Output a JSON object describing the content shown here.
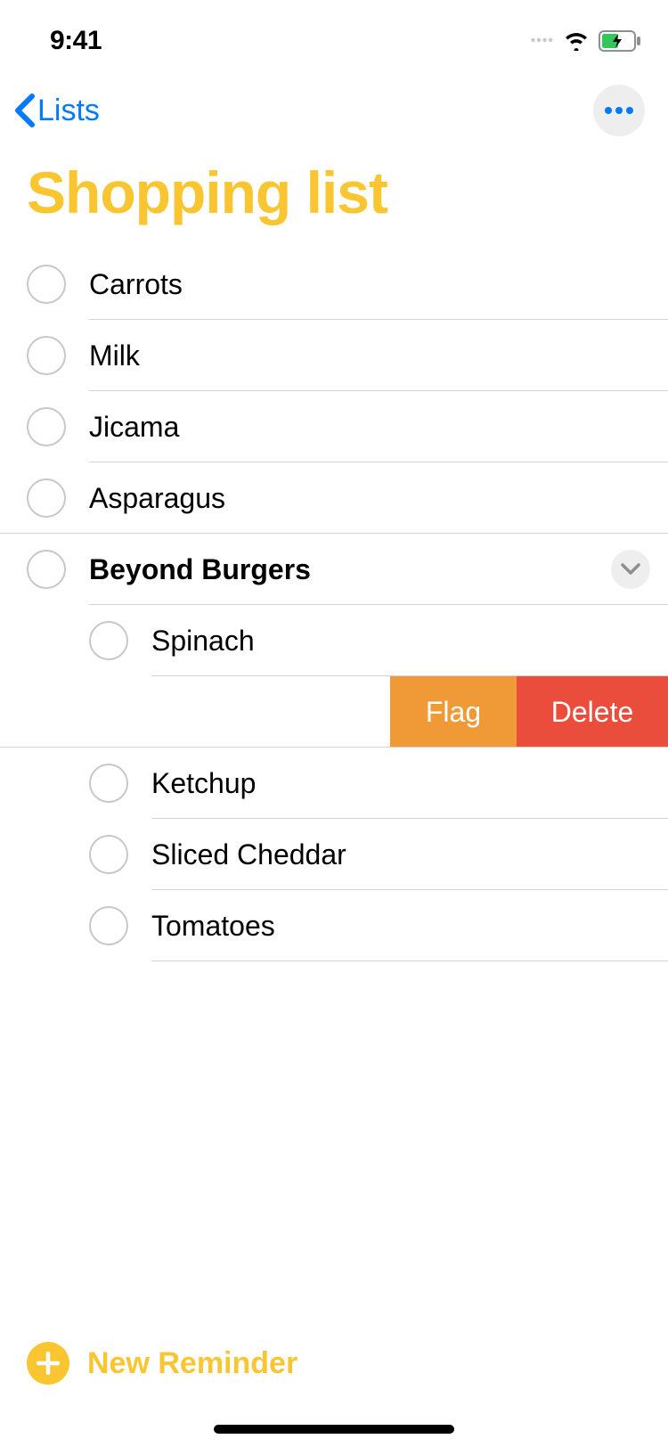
{
  "status": {
    "time": "9:41"
  },
  "nav": {
    "back_label": "Lists"
  },
  "list": {
    "title": "Shopping list"
  },
  "reminders": [
    {
      "label": "Carrots"
    },
    {
      "label": "Milk"
    },
    {
      "label": "Jicama"
    },
    {
      "label": "Asparagus"
    }
  ],
  "group": {
    "label": "Beyond Burgers"
  },
  "subitems": {
    "spinach": "Spinach",
    "ketchup": "Ketchup",
    "sliced_cheddar": "Sliced Cheddar",
    "tomatoes": "Tomatoes"
  },
  "actions": {
    "flag": "Flag",
    "delete": "Delete"
  },
  "footer": {
    "new_reminder": "New Reminder"
  }
}
